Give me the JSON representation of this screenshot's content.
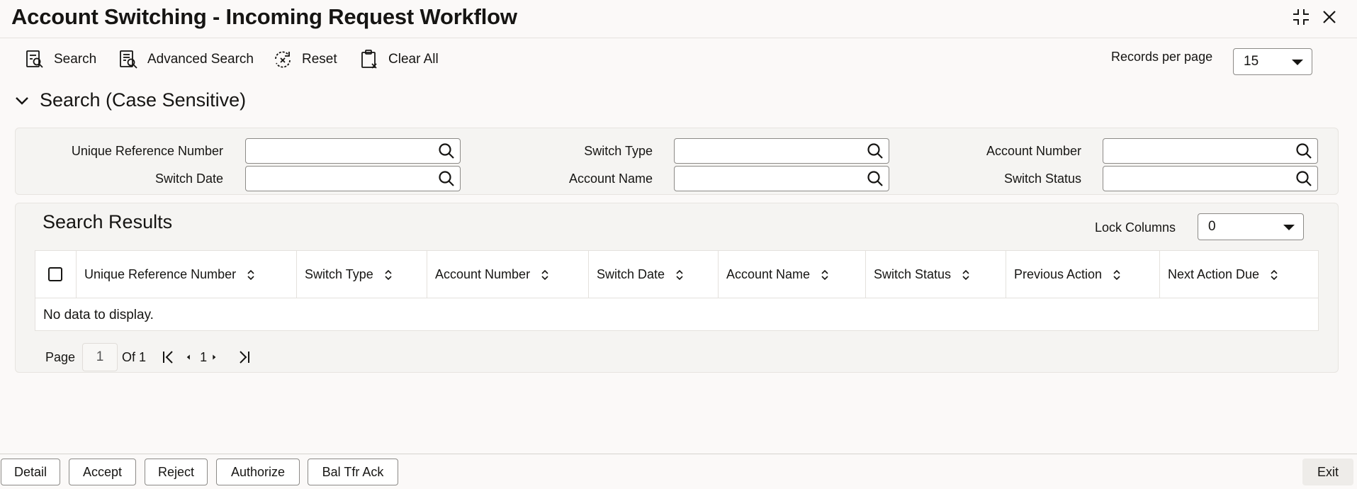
{
  "window": {
    "title": "Account Switching - Incoming Request Workflow",
    "controls": [
      "collapse-icon",
      "close-icon"
    ]
  },
  "toolbar": {
    "search_label": "Search",
    "advanced_search_label": "Advanced Search",
    "reset_label": "Reset",
    "clear_all_label": "Clear All"
  },
  "records_per_page": {
    "label": "Records per page",
    "value": "15"
  },
  "search_section": {
    "title": "Search (Case Sensitive)",
    "fields": {
      "unique_reference_number": "Unique Reference Number",
      "switch_type": "Switch Type",
      "account_number": "Account Number",
      "switch_date": "Switch Date",
      "account_name": "Account Name",
      "switch_status": "Switch Status"
    }
  },
  "results": {
    "title": "Search Results",
    "lock_columns_label": "Lock Columns",
    "lock_columns_value": "0",
    "columns": [
      "Unique Reference Number",
      "Switch Type",
      "Account Number",
      "Switch Date",
      "Account Name",
      "Switch Status",
      "Previous Action",
      "Next Action Due"
    ],
    "empty_text": "No data to display."
  },
  "pagination": {
    "page_label": "Page",
    "current_page": "1",
    "of_label": "Of 1",
    "page_number": "1"
  },
  "footer": {
    "buttons": [
      "Detail",
      "Accept",
      "Reject",
      "Authorize",
      "Bal Tfr Ack"
    ],
    "exit_label": "Exit"
  }
}
